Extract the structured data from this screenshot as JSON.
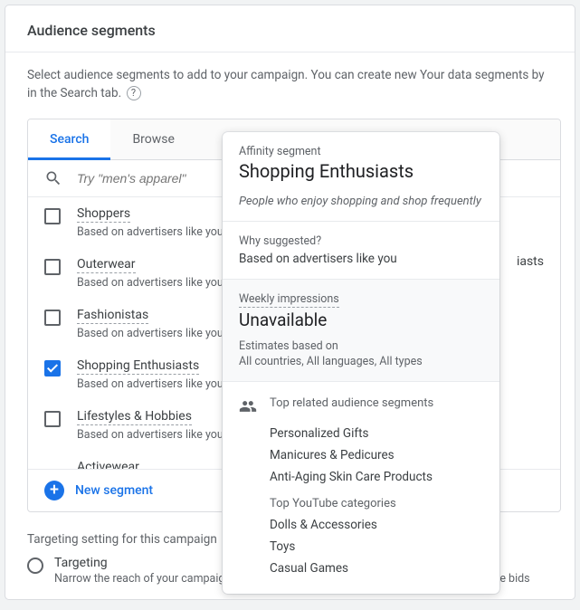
{
  "title": "Audience segments",
  "intro": "Select audience segments to add to your campaign. You can create new Your data segments by in the Search tab.",
  "tabs": {
    "search": "Search",
    "browse": "Browse"
  },
  "search": {
    "placeholder": "Try \"men's apparel\""
  },
  "rows": [
    {
      "title": "Shoppers",
      "sub": "Based on advertisers like you",
      "checked": false
    },
    {
      "title": "Outerwear",
      "sub": "Based on advertisers like you",
      "checked": false
    },
    {
      "title": "Fashionistas",
      "sub": "Based on advertisers like you",
      "checked": false
    },
    {
      "title": "Shopping Enthusiasts",
      "sub": "Based on advertisers like you",
      "checked": true
    },
    {
      "title": "Lifestyles & Hobbies",
      "sub": "Based on advertisers like you",
      "checked": false
    },
    {
      "title": "Activewear",
      "sub": "",
      "checked": false
    }
  ],
  "new_segment": "New segment",
  "targeting": {
    "intro": "Targeting setting for this campaign",
    "option_title": "Targeting",
    "option_sub": "Narrow the reach of your campaign to the selected segments, with the option to adjust the bids"
  },
  "side_label": "iasts",
  "popover": {
    "type_label": "Affinity segment",
    "title": "Shopping Enthusiasts",
    "desc": "People who enjoy shopping and shop frequently",
    "why_label": "Why suggested?",
    "why_value": "Based on advertisers like you",
    "impressions_label": "Weekly impressions",
    "impressions_value": "Unavailable",
    "estimates_label": "Estimates based on",
    "estimates_sub": "All countries, All languages, All types",
    "related_title": "Top related audience segments",
    "related_items": [
      "Personalized Gifts",
      "Manicures & Pedicures",
      "Anti-Aging Skin Care Products"
    ],
    "yt_title": "Top YouTube categories",
    "yt_items": [
      "Dolls & Accessories",
      "Toys",
      "Casual Games"
    ]
  }
}
